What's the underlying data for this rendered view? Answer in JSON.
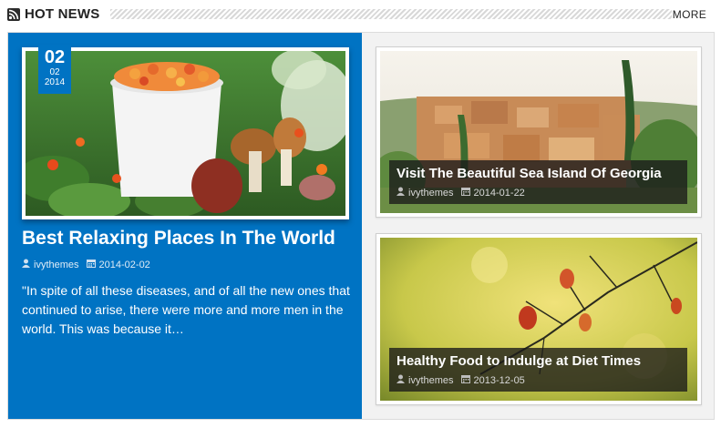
{
  "header": {
    "title": "HOT NEWS",
    "more_label": "MORE",
    "rss_icon": "rss-icon"
  },
  "featured": {
    "date": {
      "day": "02",
      "month": "02",
      "year": "2014"
    },
    "title": "Best Relaxing Places In The World",
    "author": "ivythemes",
    "date_text": "2014-02-02",
    "excerpt": "\"In spite of all these diseases, and of all the new ones that continued to arise, there were more and more men in the world. This was because it…",
    "image": "cloudberries-and-mushrooms-photo"
  },
  "side_posts": [
    {
      "title": "Visit The Beautiful Sea Island Of Georgia",
      "author": "ivythemes",
      "date_text": "2014-01-22",
      "image": "hillside-village-photo"
    },
    {
      "title": "Healthy Food to Indulge at Diet Times",
      "author": "ivythemes",
      "date_text": "2013-12-05",
      "image": "autumn-branch-photo"
    }
  ],
  "colors": {
    "accent": "#0073c3",
    "caption_bg": "#191919"
  }
}
